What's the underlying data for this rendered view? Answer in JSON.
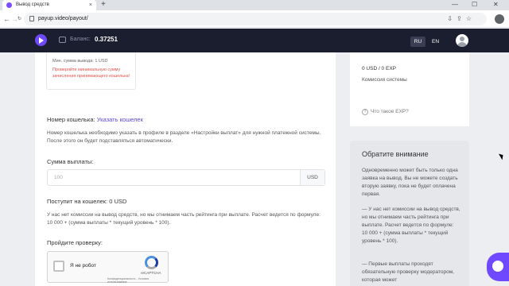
{
  "browser": {
    "tab_title": "Вывод средств",
    "tab_close": "×",
    "new_tab": "+",
    "url": "payup.video/payout/",
    "nav_back": "←",
    "nav_forward": "→",
    "nav_reload": "↻",
    "win_minimize": "—",
    "win_maximize": "☐",
    "win_close": "✕",
    "omni_icons": "⇩⇪☆"
  },
  "header": {
    "balance_label": "Баланс:",
    "balance_value": "0.37251",
    "lang_ru": "RU",
    "lang_en": "EN"
  },
  "currency_card": {
    "min_amount": "Мин. сумма вывода: 1 USD",
    "warning": "Проверяйте минимальную сумму зачисления принимающего кошелька!"
  },
  "form": {
    "wallet_label": "Номер кошелька:",
    "wallet_link": "Указать кошелек",
    "wallet_desc": "Номер кошелька необходимо указать в профиле в разделе «Настройки выплат» для нужной платежной системы. После этого он будет подставляться автоматически.",
    "amount_label": "Сумма выплаты:",
    "amount_placeholder": "100",
    "amount_currency": "USD",
    "received": "Поступит на кошелек: 0 USD",
    "commission_note": "У нас нет комиссии на вывод средств, но мы отнимаем часть рейтинга при выплате. Расчет ведется по формуле: 10 000 + (сумма выплаты * текущий уровень * 100).",
    "check_label": "Пройдите проверку:",
    "captcha_text": "Я не робот",
    "captcha_brand": "reCAPTCHA",
    "captcha_terms": "Конфиденциальность - Условия использования"
  },
  "sidebar_stats": {
    "values": "0 USD  /  0 EXP",
    "label": "Комиссия системы",
    "help": "Что такое EXP?"
  },
  "notice": {
    "title": "Обратите внимание",
    "p1": "Одновременно может быть только одна заявка на вывод. Вы не можете создать вторую заявку, пока не будет оплачена первая.",
    "p2": "— У нас нет комиссии на вывод средств, но мы отнимаем часть рейтинга при выплате. Расчет ведется по формуле: 10 000 + (сумма выплаты * текущий уровень * 100).",
    "p3": "— Первые выплаты проходят обязательную проверку модератором, которая может"
  }
}
